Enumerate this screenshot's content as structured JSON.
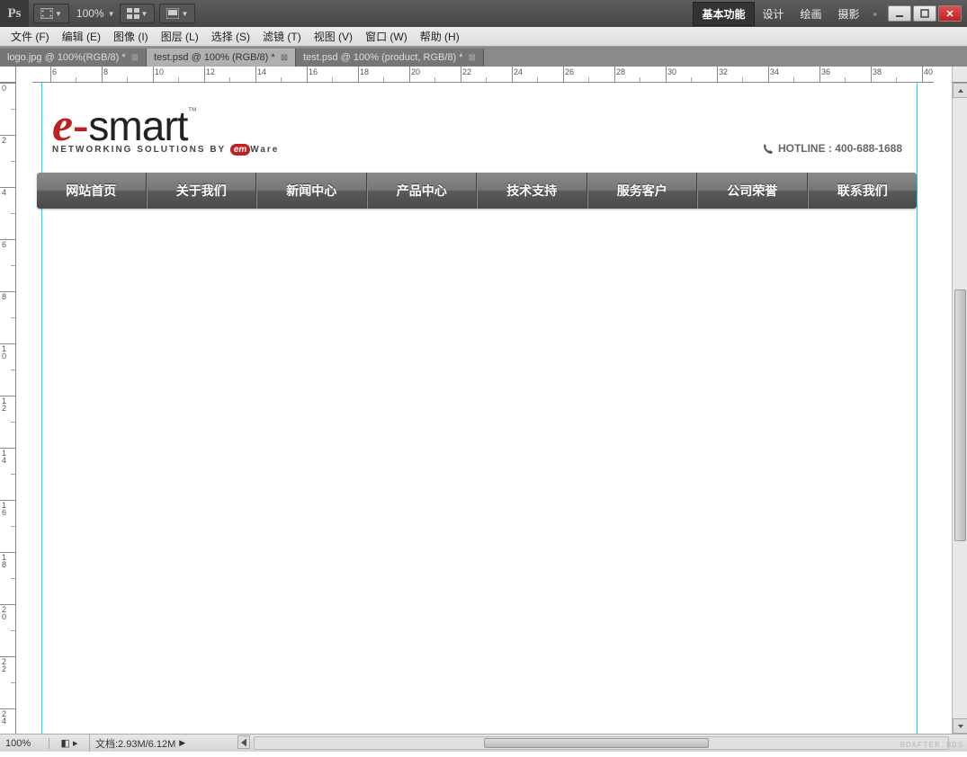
{
  "app": {
    "logo": "Ps",
    "zoom": "100%"
  },
  "workspaces": {
    "active": "基本功能",
    "items": [
      "设计",
      "绘画",
      "摄影"
    ]
  },
  "menubar": [
    "文件 (F)",
    "编辑 (E)",
    "图像 (I)",
    "图层 (L)",
    "选择 (S)",
    "滤镜 (T)",
    "视图 (V)",
    "窗口 (W)",
    "帮助 (H)"
  ],
  "tabs": [
    {
      "label": "logo.jpg @ 100%(RGB/8) *",
      "active": false
    },
    {
      "label": "test.psd @ 100% (RGB/8) *",
      "active": true
    },
    {
      "label": "test.psd @ 100% (product, RGB/8) *",
      "active": false
    }
  ],
  "ruler_h": [
    "6",
    "8",
    "10",
    "12",
    "14",
    "16",
    "18",
    "20",
    "22",
    "24",
    "26",
    "28",
    "30",
    "32",
    "34",
    "36",
    "38",
    "40"
  ],
  "ruler_v": [
    "0",
    "2",
    "4",
    "6",
    "8",
    "10",
    "12",
    "14",
    "16",
    "18",
    "20",
    "22",
    "24"
  ],
  "doc": {
    "logo": {
      "e": "e",
      "dash": "-",
      "smart": "smart",
      "tm": "™",
      "sub_pre": "NETWORKING SOLUTIONS BY ",
      "sub_em": "em",
      "sub_post": "Ware"
    },
    "hotline": "HOTLINE : 400-688-1688",
    "nav": [
      "网站首页",
      "关于我们",
      "新闻中心",
      "产品中心",
      "技术支持",
      "服务客户",
      "公司荣誉",
      "联系我们"
    ]
  },
  "status": {
    "zoom": "100%",
    "doc": "文档:2.93M/6.12M"
  },
  "watermark": "BDAFTER.BDS"
}
